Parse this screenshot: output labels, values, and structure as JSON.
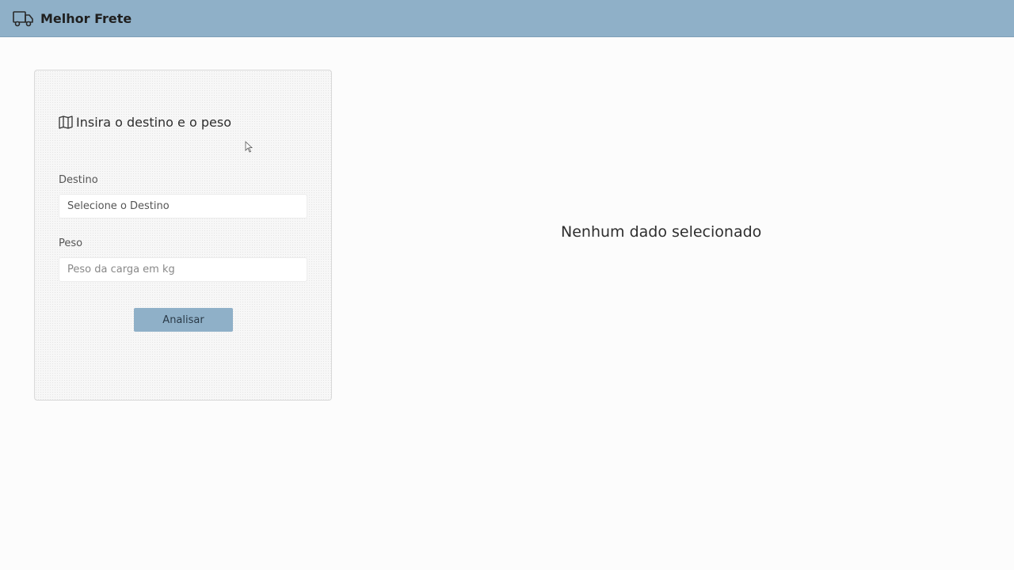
{
  "header": {
    "icon": "truck-icon",
    "title": "Melhor Frete",
    "background_color": "#8fb0c8"
  },
  "form": {
    "title_icon": "map-icon",
    "title": "Insira o destino e o peso",
    "destino": {
      "label": "Destino",
      "placeholder": "Selecione o Destino"
    },
    "peso": {
      "label": "Peso",
      "placeholder": "Peso da carga em kg"
    },
    "submit_label": "Analisar",
    "button_color": "#8fb0c8"
  },
  "results": {
    "empty_message": "Nenhum dado selecionado"
  }
}
